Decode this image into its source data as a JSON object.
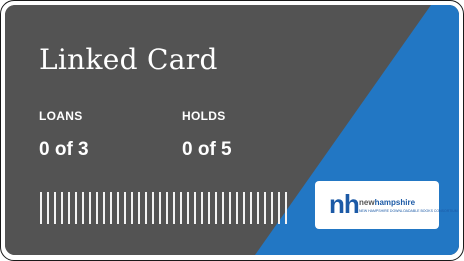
{
  "card": {
    "title": "Linked Card",
    "colors": {
      "dark": "#535353",
      "accent": "#2277c4"
    },
    "loans": {
      "label": "LOANS",
      "value": "0 of 3"
    },
    "holds": {
      "label": "HOLDS",
      "value": "0 of 5"
    },
    "barcode_icon": "barcode-icon",
    "logo": {
      "mark": "nh",
      "word_part1": "new",
      "word_part2": "hampshire",
      "tagline": "NEW HAMPSHIRE DOWNLOADABLE BOOKS CONSORTIUM"
    }
  }
}
